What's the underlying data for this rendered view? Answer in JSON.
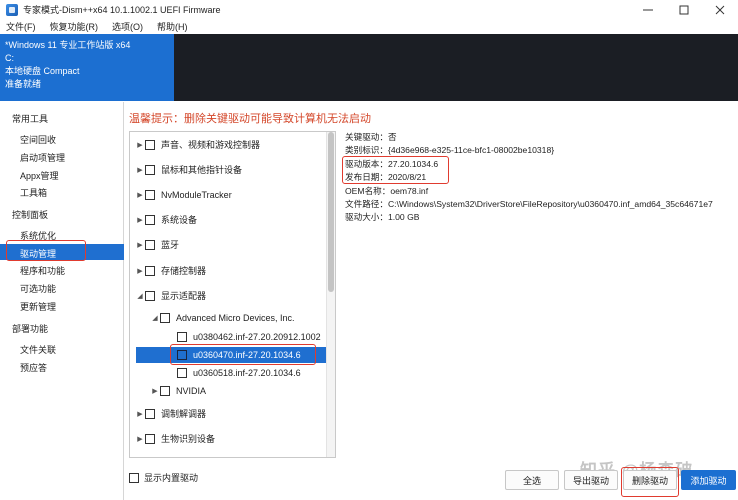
{
  "window": {
    "title": "专家模式-Dism++x64 10.1.1002.1 UEFI Firmware",
    "controls": [
      "minimize-icon",
      "maximize-icon",
      "close-icon"
    ]
  },
  "menu": [
    "文件(F)",
    "恢复功能(R)",
    "选项(O)",
    "帮助(H)"
  ],
  "system_info": {
    "os": "*Windows 11 专业工作站版 x64",
    "drive": "C:",
    "disk": "本地硬盘 Compact",
    "status": "准备就绪",
    "accent": "#1c6fd1"
  },
  "sidebar": {
    "groups": [
      {
        "label": "常用工具",
        "items": [
          "空间回收",
          "启动项管理",
          "Appx管理",
          "工具箱"
        ]
      },
      {
        "label": "控制面板",
        "items": [
          "系统优化",
          "驱动管理",
          "程序和功能",
          "可选功能",
          "更新管理"
        ]
      },
      {
        "label": "部署功能",
        "items": [
          "文件关联",
          "预应答"
        ]
      }
    ],
    "active_item": "驱动管理"
  },
  "main": {
    "warning": "温馨提示：删除关键驱动可能导致计算机无法启动",
    "tree": [
      {
        "label": "声音、视频和游戏控制器",
        "level": 0,
        "arrow": "right"
      },
      {
        "label": "鼠标和其他指针设备",
        "level": 0,
        "arrow": "right"
      },
      {
        "label": "NvModuleTracker",
        "level": 0,
        "arrow": "right"
      },
      {
        "label": "系统设备",
        "level": 0,
        "arrow": "right"
      },
      {
        "label": "蓝牙",
        "level": 0,
        "arrow": "right"
      },
      {
        "label": "存储控制器",
        "level": 0,
        "arrow": "right"
      },
      {
        "label": "显示适配器",
        "level": 0,
        "arrow": "down"
      },
      {
        "label": "Advanced Micro Devices, Inc.",
        "level": 1,
        "arrow": "down"
      },
      {
        "label": "u0380462.inf-27.20.20912.1002",
        "level": 2,
        "arrow": ""
      },
      {
        "label": "u0360470.inf-27.20.1034.6",
        "level": 2,
        "arrow": "",
        "selected": true
      },
      {
        "label": "u0360518.inf-27.20.1034.6",
        "level": 2,
        "arrow": ""
      },
      {
        "label": "NVIDIA",
        "level": 1,
        "arrow": "right"
      },
      {
        "label": "调制解调器",
        "level": 0,
        "arrow": "right"
      },
      {
        "label": "生物识别设备",
        "level": 0,
        "arrow": "right"
      }
    ],
    "details": [
      "关键驱动：否",
      "类别标识：{4d36e968-e325-11ce-bfc1-08002be10318}",
      "驱动版本：27.20.1034.6",
      "发布日期：2020/8/21",
      "OEM名称：oem78.inf",
      "文件路径：C:\\Windows\\System32\\DriverStore\\FileRepository\\u0360470.inf_amd64_35c64671e7",
      "驱动大小：1.00 GB"
    ],
    "show_builtin": "显示内置驱动",
    "buttons": [
      "全选",
      "导出驱动",
      "删除驱动",
      "添加驱动"
    ],
    "highlight_color": "#e03b2f"
  },
  "watermark": "知乎 @杨森破"
}
